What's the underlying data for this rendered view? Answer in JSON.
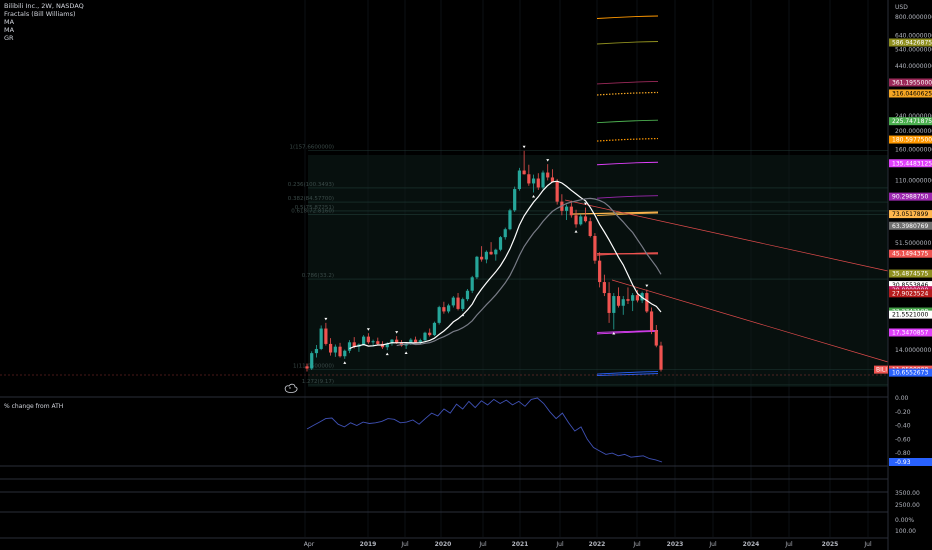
{
  "legend": {
    "symbol": "Bilibili Inc., 2W, NASDAQ",
    "indicators": [
      "Fractals (Bill Williams)",
      "MA",
      "MA",
      "GR"
    ]
  },
  "oscillator": {
    "title": "% change from ATH",
    "ticks": [
      "0.00",
      "-0.20",
      "-0.40",
      "-0.60",
      "-0.80"
    ],
    "last": "-0.93"
  },
  "sub_panels": {
    "panel_a": [],
    "panel_b": [
      "3500.00",
      "2500.00"
    ],
    "panel_c": [
      "0.00%",
      "100.00"
    ]
  },
  "price_axis": {
    "currency": "USD",
    "ticks": [
      "800.0000000",
      "640.0000000",
      "540.0000000",
      "440.0000000",
      "240.0000000",
      "200.0000000",
      "160.0000000",
      "110.0000000",
      "51.5000000",
      "14.0000000",
      "11.0000000"
    ],
    "tags": [
      {
        "text": "586.9426875",
        "color": "#8f8f1f"
      },
      {
        "text": "361.1955000",
        "color": "#9c2a5a"
      },
      {
        "text": "316.0460625",
        "color": "#f5a623"
      },
      {
        "text": "225.7471875",
        "color": "#4caf50"
      },
      {
        "text": "180.5977500",
        "color": "#ff9800"
      },
      {
        "text": "135.4483125",
        "color": "#e040fb"
      },
      {
        "text": "90.2988750",
        "color": "#9c27b0"
      },
      {
        "text": "73.0517899",
        "color": "#ffb74d"
      },
      {
        "text": "63.3980769",
        "color": "#707070"
      },
      {
        "text": "45.1494375",
        "color": "#ef5350"
      },
      {
        "text": "35.4874575",
        "color": "#8f8f1f"
      },
      {
        "text": "30.8553846",
        "color": "#ffffff"
      },
      {
        "text": "29.0000000",
        "color": "#c2185b"
      },
      {
        "text": "27.9023524",
        "color": "#b71c1c"
      },
      {
        "text": "22.3742108",
        "color": "#43a047"
      },
      {
        "text": "21.5521000",
        "color": "#ffffff"
      },
      {
        "text": "17.3470857",
        "color": "#e040fb"
      },
      {
        "text": "11.0500000",
        "color": "#ef5350",
        "prefix": "BILI"
      },
      {
        "text": "10.6552673",
        "color": "#2962ff"
      }
    ]
  },
  "time_axis": [
    "Apr",
    "2019",
    "Jul",
    "2020",
    "Jul",
    "2021",
    "Jul",
    "2022",
    "Jul",
    "2023",
    "Jul",
    "2024",
    "Jul",
    "2025",
    "Jul"
  ],
  "fib_labels": [
    "1(157.6600000)",
    "0.236(100.3493)",
    "0.382(84.57700)",
    "0.5(75.87251)",
    "0.618(72.8160)",
    "0.786(33.2)",
    "1(11.0500000)",
    "1.272(9.17)"
  ],
  "chart_data": {
    "type": "candlestick",
    "title": "Bilibili Inc., 2W, NASDAQ",
    "x_start": "2018-04",
    "x_end": "2025-08",
    "ylim": [
      10,
      800
    ],
    "y_scale": "log",
    "ohlc": [
      [
        11.5,
        11.9,
        10.8,
        11.2
      ],
      [
        11.2,
        13.8,
        11.0,
        13.5
      ],
      [
        13.5,
        14.9,
        12.8,
        14.2
      ],
      [
        14.2,
        18.9,
        14.0,
        18.2
      ],
      [
        18.2,
        19.5,
        14.8,
        15.1
      ],
      [
        15.1,
        16.2,
        13.1,
        13.6
      ],
      [
        13.6,
        15.0,
        12.9,
        14.6
      ],
      [
        14.6,
        15.3,
        12.8,
        13.0
      ],
      [
        13.0,
        14.1,
        12.6,
        13.9
      ],
      [
        13.9,
        15.8,
        13.5,
        15.4
      ],
      [
        15.4,
        16.4,
        14.3,
        14.6
      ],
      [
        14.6,
        15.2,
        13.7,
        15.0
      ],
      [
        15.0,
        16.8,
        14.8,
        16.5
      ],
      [
        16.5,
        17.2,
        15.1,
        15.4
      ],
      [
        15.4,
        15.9,
        14.6,
        15.6
      ],
      [
        15.6,
        16.3,
        14.9,
        15.1
      ],
      [
        15.1,
        15.6,
        14.2,
        14.5
      ],
      [
        14.5,
        15.4,
        14.0,
        15.2
      ],
      [
        15.2,
        16.0,
        14.8,
        15.9
      ],
      [
        15.9,
        16.6,
        15.1,
        15.3
      ],
      [
        15.3,
        15.8,
        14.6,
        14.8
      ],
      [
        14.8,
        15.3,
        14.2,
        15.1
      ],
      [
        15.1,
        16.2,
        14.9,
        15.9
      ],
      [
        15.9,
        16.5,
        15.2,
        15.4
      ],
      [
        15.4,
        16.1,
        15.0,
        15.8
      ],
      [
        15.8,
        17.5,
        15.6,
        17.3
      ],
      [
        17.3,
        18.2,
        16.5,
        16.8
      ],
      [
        16.8,
        19.8,
        16.6,
        19.5
      ],
      [
        19.5,
        24.0,
        19.1,
        23.6
      ],
      [
        23.6,
        25.2,
        21.8,
        22.4
      ],
      [
        22.4,
        24.6,
        21.9,
        24.1
      ],
      [
        24.1,
        27.0,
        23.5,
        26.5
      ],
      [
        26.5,
        28.0,
        22.7,
        23.1
      ],
      [
        23.1,
        26.5,
        22.5,
        26.0
      ],
      [
        26.0,
        29.4,
        25.4,
        28.8
      ],
      [
        28.8,
        34.5,
        28.0,
        33.9
      ],
      [
        33.9,
        44.0,
        33.2,
        43.5
      ],
      [
        43.5,
        49.5,
        41.0,
        42.1
      ],
      [
        42.1,
        47.0,
        40.2,
        46.2
      ],
      [
        46.2,
        52.0,
        44.5,
        44.8
      ],
      [
        44.8,
        48.0,
        41.5,
        47.4
      ],
      [
        47.4,
        56.0,
        46.5,
        55.2
      ],
      [
        55.2,
        62.0,
        53.6,
        60.8
      ],
      [
        60.8,
        78.0,
        60.0,
        76.5
      ],
      [
        76.5,
        102.0,
        75.0,
        99.0
      ],
      [
        99.0,
        128.0,
        97.0,
        124.0
      ],
      [
        124.0,
        157.7,
        118.0,
        118.5
      ],
      [
        118.5,
        133.0,
        103.0,
        106.0
      ],
      [
        106.0,
        118.0,
        95.0,
        112.5
      ],
      [
        112.5,
        120.0,
        98.0,
        101.0
      ],
      [
        101.0,
        124.0,
        99.0,
        121.0
      ],
      [
        121.0,
        134.0,
        110.0,
        114.0
      ],
      [
        114.0,
        126.0,
        107.0,
        108.0
      ],
      [
        108.0,
        112.0,
        82.0,
        85.0
      ],
      [
        85.0,
        93.0,
        72.0,
        76.0
      ],
      [
        76.0,
        82.0,
        68.0,
        80.0
      ],
      [
        80.0,
        86.0,
        70.0,
        72.0
      ],
      [
        72.0,
        77.0,
        62.0,
        64.5
      ],
      [
        64.5,
        73.0,
        63.5,
        71.0
      ],
      [
        71.0,
        79.0,
        66.0,
        67.0
      ],
      [
        67.0,
        70.0,
        55.0,
        56.0
      ],
      [
        56.0,
        58.0,
        40.0,
        41.5
      ],
      [
        41.5,
        46.0,
        30.0,
        32.0
      ],
      [
        32.0,
        35.0,
        27.0,
        28.0
      ],
      [
        28.0,
        32.0,
        19.5,
        22.0
      ],
      [
        22.0,
        28.0,
        18.0,
        27.0
      ],
      [
        27.0,
        30.0,
        23.5,
        24.0
      ],
      [
        24.0,
        27.0,
        21.5,
        26.0
      ],
      [
        26.0,
        30.0,
        24.5,
        25.5
      ],
      [
        25.5,
        28.0,
        22.5,
        27.3
      ],
      [
        27.3,
        29.0,
        25.0,
        25.6
      ],
      [
        25.6,
        28.5,
        24.8,
        28.0
      ],
      [
        28.0,
        29.2,
        22.0,
        22.4
      ],
      [
        22.4,
        23.5,
        17.0,
        17.8
      ],
      [
        17.8,
        19.0,
        14.5,
        14.8
      ],
      [
        14.8,
        15.5,
        10.8,
        11.05
      ]
    ],
    "oscillator_pct_from_ath": [
      -0.45,
      -0.4,
      -0.35,
      -0.3,
      -0.29,
      -0.38,
      -0.42,
      -0.36,
      -0.4,
      -0.35,
      -0.37,
      -0.36,
      -0.34,
      -0.3,
      -0.31,
      -0.36,
      -0.35,
      -0.32,
      -0.38,
      -0.3,
      -0.22,
      -0.26,
      -0.16,
      -0.22,
      -0.09,
      -0.16,
      -0.05,
      -0.14,
      -0.04,
      -0.1,
      -0.02,
      -0.08,
      -0.03,
      -0.1,
      -0.05,
      -0.12,
      -0.02,
      0.0,
      -0.08,
      -0.2,
      -0.3,
      -0.22,
      -0.36,
      -0.48,
      -0.42,
      -0.6,
      -0.72,
      -0.77,
      -0.82,
      -0.8,
      -0.84,
      -0.82,
      -0.86,
      -0.85,
      -0.84,
      -0.88,
      -0.9,
      -0.93
    ],
    "fib_levels": [
      157.66,
      100.35,
      84.58,
      75.87,
      72.82,
      33.2,
      11.05,
      9.17
    ],
    "projection_lines": [
      {
        "value": 800.0,
        "color": "#ff9800",
        "style": "solid"
      },
      {
        "value": 586.94,
        "color": "#8f8f1f",
        "style": "solid"
      },
      {
        "value": 361.2,
        "color": "#9c2a5a",
        "style": "solid"
      },
      {
        "value": 316.05,
        "color": "#f5a623",
        "style": "dotted"
      },
      {
        "value": 225.75,
        "color": "#4caf50",
        "style": "solid"
      },
      {
        "value": 180.6,
        "color": "#ff9800",
        "style": "dotted"
      },
      {
        "value": 135.45,
        "color": "#e040fb",
        "style": "solid"
      },
      {
        "value": 90.3,
        "color": "#9c27b0",
        "style": "solid"
      },
      {
        "value": 73.05,
        "color": "#ffb74d",
        "style": "solid"
      },
      {
        "value": 45.15,
        "color": "#ef5350",
        "style": "solid"
      },
      {
        "value": 17.35,
        "color": "#e040fb",
        "style": "solid"
      },
      {
        "value": 10.66,
        "color": "#2962ff",
        "style": "solid"
      }
    ],
    "colors": {
      "up": "#26a69a",
      "down": "#ef5350",
      "ma_fast": "#ffffff",
      "ma_slow": "#787b86",
      "osc": "#3f51b5"
    }
  }
}
